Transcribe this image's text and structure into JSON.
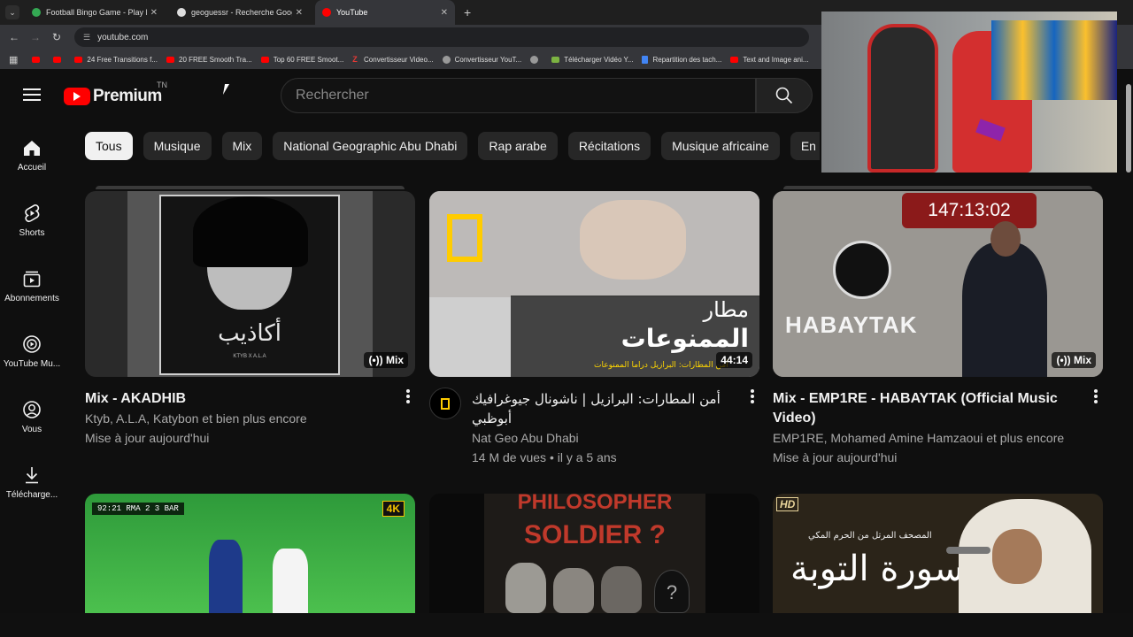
{
  "browser": {
    "tabs": [
      {
        "title": "Football Bingo Game - Play Now",
        "favicon_color": "#34a853",
        "active": false
      },
      {
        "title": "geoguessr - Recherche Google",
        "favicon_color": "#dddddd",
        "active": false
      },
      {
        "title": "YouTube",
        "favicon_color": "#ff0000",
        "active": true
      }
    ],
    "url": "youtube.com",
    "bookmarks": [
      {
        "label": "",
        "icon": "youtube"
      },
      {
        "label": "",
        "icon": "youtube"
      },
      {
        "label": "24 Free Transitions f...",
        "icon": "youtube"
      },
      {
        "label": "20 FREE Smooth Tra...",
        "icon": "youtube"
      },
      {
        "label": "Top 60 FREE Smoot...",
        "icon": "youtube"
      },
      {
        "label": "Convertisseur Video...",
        "icon": "z"
      },
      {
        "label": "Convertisseur YouT...",
        "icon": "globe"
      },
      {
        "label": "",
        "icon": "globe"
      },
      {
        "label": "Télécharger Vidéo Y...",
        "icon": "download"
      },
      {
        "label": "Repartition des tach...",
        "icon": "doc"
      },
      {
        "label": "Text and Image ani...",
        "icon": "youtube"
      }
    ]
  },
  "youtube": {
    "logo_text": "Premium",
    "country_code": "TN",
    "search_placeholder": "Rechercher",
    "sidebar": [
      {
        "label": "Accueil",
        "icon": "home-icon"
      },
      {
        "label": "Shorts",
        "icon": "shorts-icon"
      },
      {
        "label": "Abonnements",
        "icon": "subscriptions-icon"
      },
      {
        "label": "YouTube Mu...",
        "icon": "youtube-music-icon"
      },
      {
        "label": "Vous",
        "icon": "you-icon"
      },
      {
        "label": "Télécharge...",
        "icon": "download-icon"
      }
    ],
    "chips": [
      "Tous",
      "Musique",
      "Mix",
      "National Geographic Abu Dhabi",
      "Rap arabe",
      "Récitations",
      "Musique africaine",
      "En"
    ],
    "videos": [
      {
        "title": "Mix - AKADHIB",
        "meta1": "Ktyb, A.L.A, Katybon et bien plus encore",
        "meta2": "Mise à jour aujourd'hui",
        "badge": "Mix",
        "thumb_text": "أكاذيب",
        "thumb_small": "KTYB X A.L.A"
      },
      {
        "title": "أمن المطارات: البرازيل | ناشونال جيوغرافيك أبوظبي",
        "meta1": "Nat Geo Abu Dhabi",
        "meta2": "14 M de vues • il y a 5 ans",
        "badge": "44:14",
        "thumb_text": "مطار",
        "thumb_text2": "الممنوعات",
        "thumb_small": "أمن المطارات: البرازيل دراما الممنوعات"
      },
      {
        "title": "Mix - EMP1RE - HABAYTAK (Official Music Video)",
        "meta1": "EMP1RE, Mohamed Amine Hamzaoui et plus encore",
        "meta2": "Mise à jour aujourd'hui",
        "badge": "Mix",
        "thumb_text": "HABAYTAK",
        "timer": "147:13:02"
      },
      {
        "scoreboard": "92:21  RMA 2 3 BAR",
        "quality": "4K"
      },
      {
        "thumb_text": "PHILOSOPHER",
        "thumb_text2": "SOLDIER ?"
      },
      {
        "thumb_text": "سورة التوبة",
        "thumb_small": "المصحف المرتل من الحرم المكي",
        "quality": "HD"
      }
    ]
  }
}
